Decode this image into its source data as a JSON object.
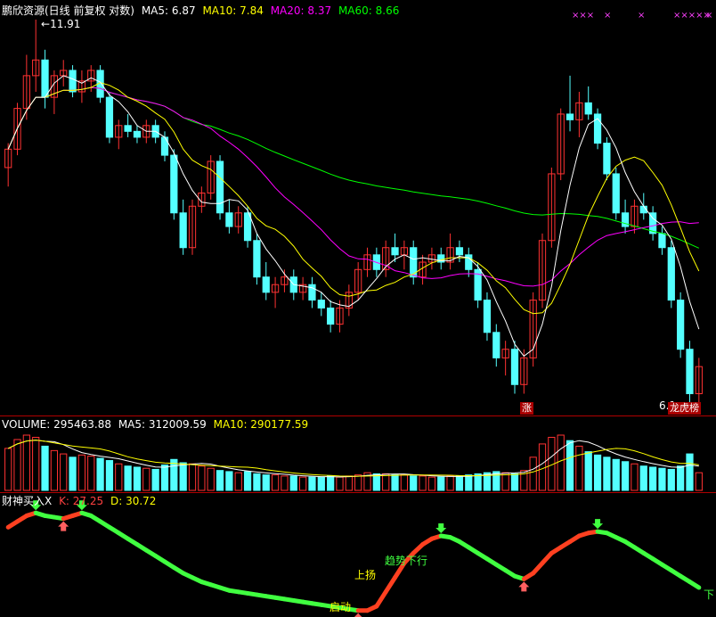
{
  "header": {
    "stock_title": "鹏欣资源(日线 前复权 对数)",
    "ma_labels": [
      {
        "label": "MA5: 6.87",
        "color": "#ffffff"
      },
      {
        "label": "MA10: 7.84",
        "color": "#ffff00"
      },
      {
        "label": "MA20: 8.37",
        "color": "#ff00ff"
      },
      {
        "label": "MA60: 8.66",
        "color": "#00ff00"
      }
    ]
  },
  "volume_header": {
    "label": "VOLUME: 295463.88",
    "ma5": "MA5: 312009.59",
    "ma10": "MA10: 290177.59"
  },
  "indicator_header": {
    "name": "财神买入X",
    "k": "K: 27.25",
    "d": "D: 30.72"
  },
  "annotations": {
    "high_price": "11.91",
    "low_price": "6.1",
    "zhang_tag": "涨",
    "top_list_tag": "龙虎榜",
    "qidong": "启动",
    "shangyang": "上扬",
    "trend_down": "趋势下行",
    "xia": "下",
    "x_marks": [
      "×××",
      "×",
      "×",
      "×××××",
      "×"
    ]
  },
  "colors": {
    "up": "#ff3232",
    "down": "#54ffff",
    "ma5": "#ffffff",
    "ma10": "#ffff00",
    "ma20": "#ff00ff",
    "ma60": "#00ff00",
    "k_up": "#ff4020",
    "k_down": "#40ff40"
  },
  "chart_data": [
    {
      "type": "candlestick",
      "title": "鹏欣资源(日线 前复权 对数)",
      "scale": "log",
      "ylim": [
        6.1,
        11.91
      ],
      "max_label": 11.91,
      "min_label": 6.1,
      "candles": [
        [
          9.2,
          9.6,
          8.9,
          9.5
        ],
        [
          9.5,
          10.3,
          9.4,
          10.2
        ],
        [
          10.2,
          11.2,
          10.0,
          10.8
        ],
        [
          10.8,
          11.91,
          10.5,
          11.1
        ],
        [
          11.1,
          11.3,
          10.2,
          10.4
        ],
        [
          10.4,
          10.9,
          10.1,
          10.8
        ],
        [
          10.8,
          11.1,
          10.6,
          10.9
        ],
        [
          10.9,
          11.0,
          10.4,
          10.5
        ],
        [
          10.5,
          10.9,
          10.3,
          10.7
        ],
        [
          10.7,
          11.0,
          10.5,
          10.9
        ],
        [
          10.9,
          11.0,
          10.3,
          10.4
        ],
        [
          10.4,
          10.5,
          9.6,
          9.7
        ],
        [
          9.7,
          10.0,
          9.5,
          9.9
        ],
        [
          9.9,
          10.1,
          9.7,
          9.8
        ],
        [
          9.8,
          9.9,
          9.6,
          9.7
        ],
        [
          9.7,
          10.0,
          9.6,
          9.9
        ],
        [
          9.9,
          10.0,
          9.6,
          9.7
        ],
        [
          9.7,
          9.8,
          9.3,
          9.4
        ],
        [
          9.4,
          9.5,
          8.4,
          8.5
        ],
        [
          8.5,
          8.7,
          7.9,
          8.0
        ],
        [
          8.0,
          8.7,
          7.9,
          8.6
        ],
        [
          8.6,
          8.9,
          8.5,
          8.8
        ],
        [
          8.8,
          9.4,
          8.7,
          9.3
        ],
        [
          9.3,
          9.4,
          8.4,
          8.5
        ],
        [
          8.5,
          8.7,
          8.2,
          8.3
        ],
        [
          8.3,
          8.6,
          8.2,
          8.5
        ],
        [
          8.5,
          8.6,
          8.0,
          8.1
        ],
        [
          8.1,
          8.2,
          7.5,
          7.6
        ],
        [
          7.6,
          7.8,
          7.3,
          7.4
        ],
        [
          7.4,
          7.6,
          7.2,
          7.5
        ],
        [
          7.5,
          7.7,
          7.4,
          7.6
        ],
        [
          7.6,
          7.7,
          7.3,
          7.4
        ],
        [
          7.4,
          7.6,
          7.3,
          7.5
        ],
        [
          7.5,
          7.6,
          7.2,
          7.3
        ],
        [
          7.3,
          7.4,
          7.1,
          7.2
        ],
        [
          7.2,
          7.3,
          6.9,
          7.0
        ],
        [
          7.0,
          7.3,
          6.9,
          7.2
        ],
        [
          7.2,
          7.5,
          7.1,
          7.4
        ],
        [
          7.4,
          7.8,
          7.3,
          7.7
        ],
        [
          7.7,
          8.0,
          7.6,
          7.9
        ],
        [
          7.9,
          8.0,
          7.6,
          7.7
        ],
        [
          7.7,
          8.1,
          7.6,
          8.0
        ],
        [
          8.0,
          8.2,
          7.8,
          7.9
        ],
        [
          7.9,
          8.1,
          7.7,
          8.0
        ],
        [
          8.0,
          8.1,
          7.5,
          7.6
        ],
        [
          7.6,
          7.9,
          7.5,
          7.8
        ],
        [
          7.8,
          8.0,
          7.7,
          7.9
        ],
        [
          7.9,
          8.0,
          7.7,
          7.8
        ],
        [
          7.8,
          8.2,
          7.7,
          8.0
        ],
        [
          8.0,
          8.1,
          7.8,
          7.9
        ],
        [
          7.9,
          8.0,
          7.6,
          7.7
        ],
        [
          7.7,
          7.8,
          7.2,
          7.3
        ],
        [
          7.3,
          7.4,
          6.8,
          6.9
        ],
        [
          6.9,
          7.0,
          6.5,
          6.6
        ],
        [
          6.6,
          6.8,
          6.4,
          6.7
        ],
        [
          6.7,
          6.8,
          6.2,
          6.3
        ],
        [
          6.3,
          6.7,
          6.2,
          6.6
        ],
        [
          6.6,
          7.4,
          6.5,
          7.3
        ],
        [
          7.3,
          8.2,
          7.2,
          8.1
        ],
        [
          8.1,
          9.2,
          8.0,
          9.1
        ],
        [
          9.1,
          10.2,
          9.0,
          10.1
        ],
        [
          10.1,
          10.8,
          9.8,
          10.0
        ],
        [
          10.0,
          10.5,
          9.7,
          10.3
        ],
        [
          10.3,
          10.6,
          10.0,
          10.1
        ],
        [
          10.1,
          10.2,
          9.5,
          9.6
        ],
        [
          9.6,
          9.7,
          9.0,
          9.1
        ],
        [
          9.1,
          9.2,
          8.4,
          8.5
        ],
        [
          8.5,
          8.7,
          8.2,
          8.3
        ],
        [
          8.3,
          8.7,
          8.2,
          8.6
        ],
        [
          8.6,
          8.8,
          8.4,
          8.5
        ],
        [
          8.5,
          8.6,
          8.1,
          8.2
        ],
        [
          8.2,
          8.3,
          7.9,
          8.0
        ],
        [
          8.0,
          8.1,
          7.2,
          7.3
        ],
        [
          7.3,
          7.4,
          6.6,
          6.7
        ],
        [
          6.7,
          6.8,
          6.1,
          6.2
        ],
        [
          6.2,
          6.6,
          6.1,
          6.5
        ]
      ],
      "ma_last": {
        "MA5": 6.87,
        "MA10": 7.84,
        "MA20": 8.37,
        "MA60": 8.66
      }
    },
    {
      "type": "bar",
      "title": "VOLUME",
      "series": [
        {
          "name": "VOLUME",
          "values": [
            38,
            46,
            50,
            48,
            40,
            36,
            33,
            30,
            32,
            31,
            29,
            27,
            24,
            22,
            21,
            20,
            19,
            23,
            28,
            25,
            24,
            22,
            20,
            18,
            17,
            16,
            17,
            15,
            14,
            14,
            13,
            13,
            12,
            12,
            12,
            13,
            12,
            13,
            14,
            16,
            15,
            15,
            14,
            14,
            13,
            13,
            12,
            12,
            13,
            13,
            14,
            15,
            16,
            17,
            16,
            15,
            18,
            30,
            42,
            48,
            50,
            45,
            40,
            35,
            32,
            30,
            28,
            26,
            24,
            22,
            21,
            20,
            19,
            22,
            33,
            16
          ]
        }
      ],
      "last": 295463.88,
      "MA5": 312009.59,
      "MA10": 290177.59
    },
    {
      "type": "line",
      "title": "财神买入X",
      "series": [
        {
          "name": "K",
          "values": [
            80,
            84,
            88,
            90,
            88,
            87,
            86,
            88,
            90,
            88,
            84,
            80,
            76,
            72,
            68,
            64,
            60,
            56,
            52,
            48,
            45,
            42,
            40,
            38,
            36,
            35,
            34,
            33,
            32,
            31,
            30,
            29,
            28,
            27,
            26,
            25,
            24,
            23,
            22,
            22,
            25,
            35,
            45,
            55,
            62,
            68,
            72,
            74,
            73,
            70,
            66,
            62,
            58,
            54,
            50,
            46,
            44,
            48,
            55,
            62,
            66,
            70,
            74,
            76,
            77,
            76,
            73,
            70,
            66,
            62,
            58,
            54,
            50,
            46,
            42,
            38
          ]
        }
      ],
      "K": 27.25,
      "D": 30.72
    }
  ]
}
